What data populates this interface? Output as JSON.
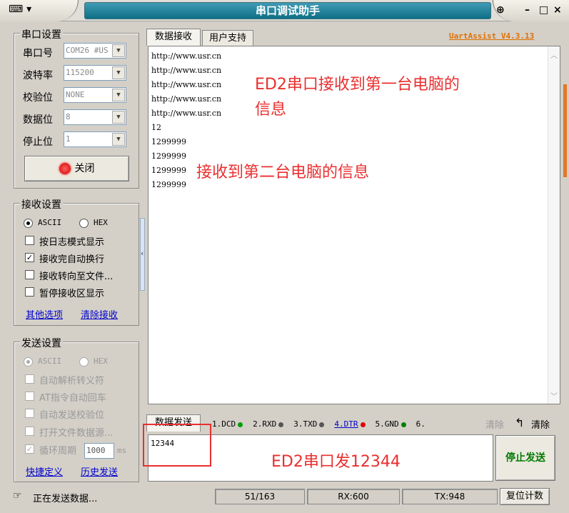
{
  "window": {
    "title": "串口调试助手",
    "min": "–",
    "max": "□",
    "close": "×",
    "pin": "⊕"
  },
  "serial_settings": {
    "title": "串口设置",
    "port_label": "串口号",
    "port_value": "COM26 #US",
    "baud_label": "波特率",
    "baud_value": "115200",
    "parity_label": "校验位",
    "parity_value": "NONE",
    "databits_label": "数据位",
    "databits_value": "8",
    "stopbits_label": "停止位",
    "stopbits_value": "1",
    "open_button": "关闭"
  },
  "recv_settings": {
    "title": "接收设置",
    "ascii": "ASCII",
    "hex": "HEX",
    "opt1": "按日志模式显示",
    "opt2": "接收完自动换行",
    "opt3": "接收转向至文件...",
    "opt4": "暂停接收区显示",
    "link1": "其他选项",
    "link2": "清除接收"
  },
  "send_settings": {
    "title": "发送设置",
    "ascii": "ASCII",
    "hex": "HEX",
    "opt1": "自动解析转义符",
    "opt2": "AT指令自动回车",
    "opt3": "自动发送校验位",
    "opt4": "打开文件数据源...",
    "opt5": "循环周期",
    "period_value": "1000",
    "period_unit": "ms",
    "link1": "快捷定义",
    "link2": "历史发送"
  },
  "tabs": {
    "recv": "数据接收",
    "plugin": "用户支持"
  },
  "version": "UartAssist V4.3.13",
  "receive_lines": [
    "http://www.usr.cn",
    "http://www.usr.cn",
    "http://www.usr.cn",
    "http://www.usr.cn",
    "http://www.usr.cn",
    "12",
    "1299999",
    "1299999",
    "1299999",
    "1299999"
  ],
  "annotations": {
    "a1_line1": "ED2串口接收到第一台电脑的",
    "a1_line2": "信息",
    "a2": "接收到第二台电脑的信息",
    "a3": "ED2串口发12344"
  },
  "send_bar": {
    "tab": "数据发送",
    "dcd": "1.DCD",
    "rxd": "2.RXD",
    "txd": "3.TXD",
    "dtr": "4.DTR",
    "gnd": "5.GND",
    "six": "6.",
    "clear1": "清除",
    "clear2": "清除",
    "dot_colors": {
      "dcd": "#00a000",
      "rxd": "#555555",
      "txd": "#555555",
      "dtr": "#e00000",
      "gnd": "#008000"
    }
  },
  "send_text": "12344",
  "stop_send_button": "停止发送",
  "statusbar": {
    "message": "正在发送数据...",
    "progress": "51/163",
    "rx": "RX:600",
    "tx": "TX:948",
    "reset_button": "复位计数"
  }
}
